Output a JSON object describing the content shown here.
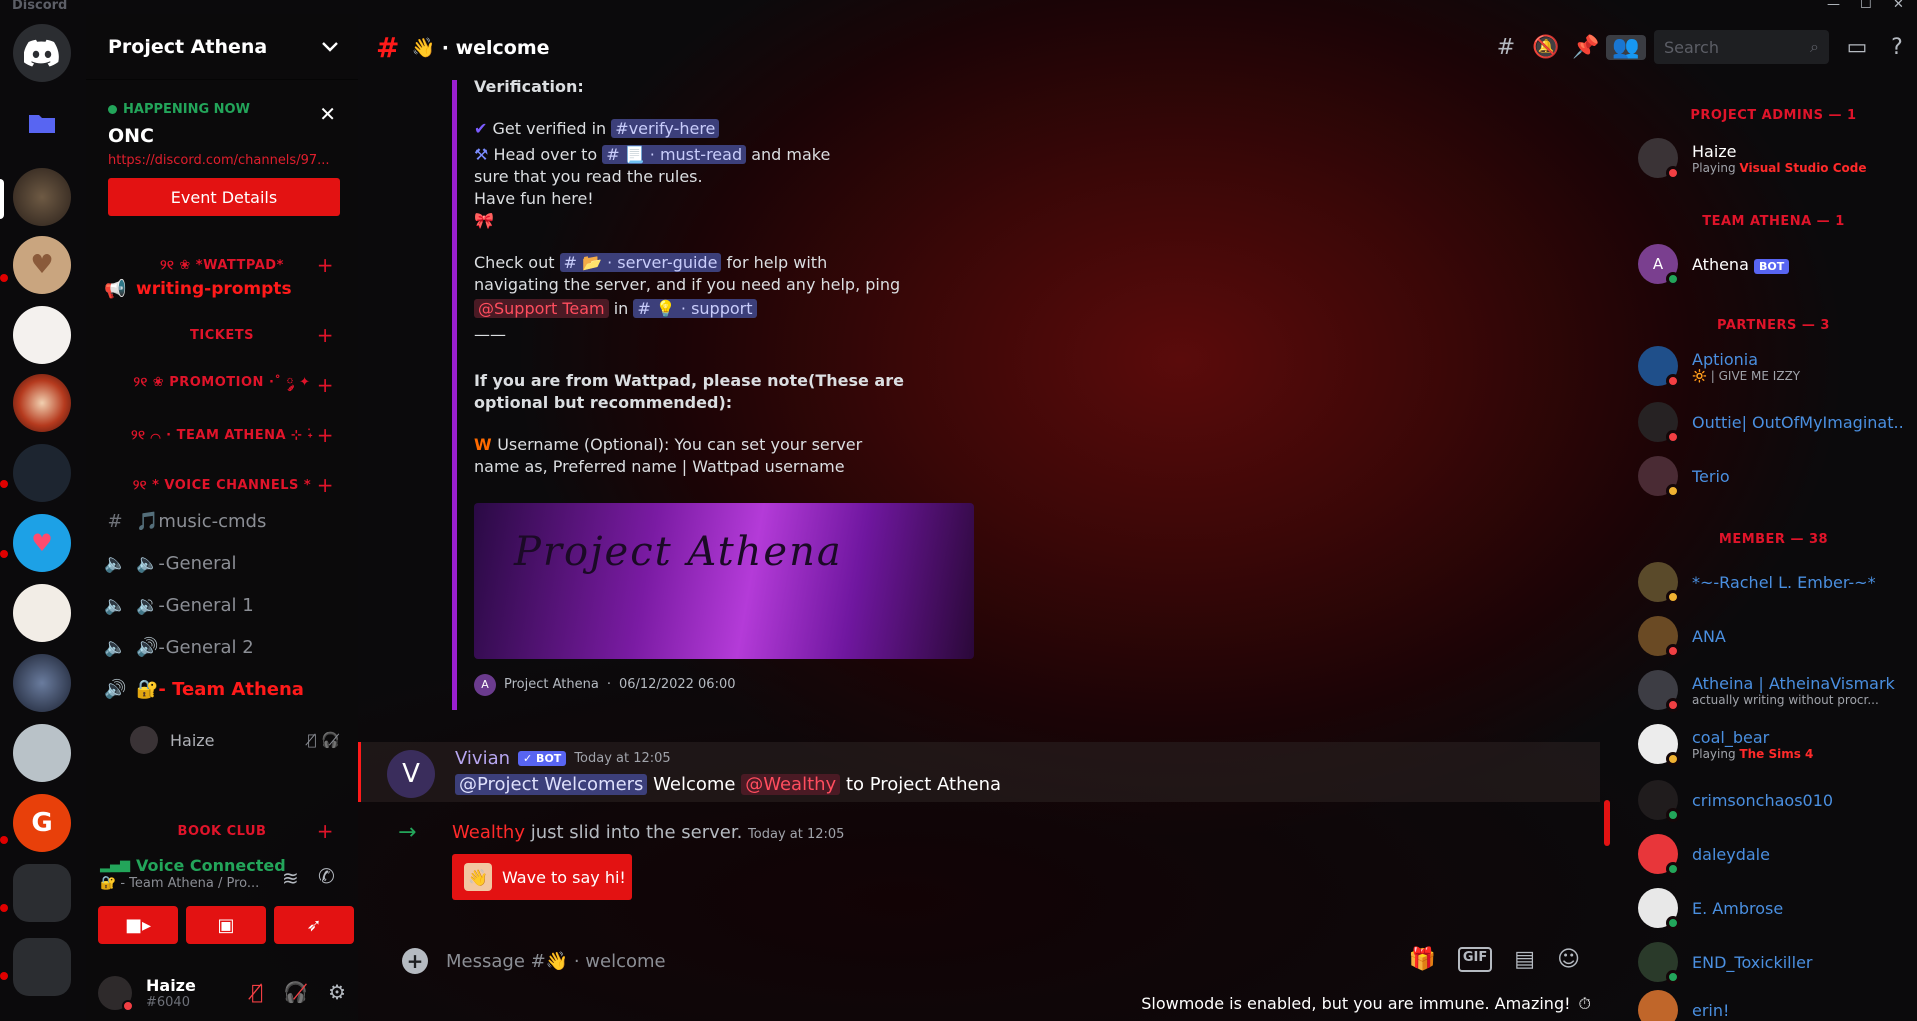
{
  "app": {
    "brand": "Discord"
  },
  "window": {
    "min": "—",
    "max": "☐",
    "close": "✕"
  },
  "server": {
    "name": "Project Athena"
  },
  "event": {
    "status": "HAPPENING NOW",
    "title": "ONC",
    "link": "https://discord.com/channels/97...",
    "button": "Event Details"
  },
  "channels": {
    "cat_wattpad": "୨୧ ❀ *WATTPAD* ",
    "writing_prompts": "writing-prompts",
    "cat_tickets": "TICKETS",
    "cat_promotion": "୨୧ ❀ PROMOTION ·˚ ༘ ✦",
    "cat_team": "୨୧ ⌒ · TEAM ATHENA ⊹ ࣪˖",
    "cat_voice": "୨୧ * VOICE CHANNELS *",
    "music": "🎵music-cmds",
    "general": "🔈-General",
    "general1": "🔉-General 1",
    "general2": "🔊-General 2",
    "team": "🔐- Team Athena",
    "voice_user": "Haize",
    "cat_book": "BOOK CLUB"
  },
  "voice": {
    "status": "Voice Connected",
    "sub": "🔐 - Team Athena / Pro..."
  },
  "user": {
    "name": "Haize",
    "tag": "#6040"
  },
  "topbar": {
    "channel": "👋 · welcome",
    "search_placeholder": "Search"
  },
  "embed": {
    "heading": "Verification:",
    "l1_a": "Get verified in",
    "l1_chip": "#verify-here",
    "l2_a": "Head over to",
    "l2_chip": "# 📃 · must-read",
    "l2_b": "and make",
    "l3": "sure that you read the rules.",
    "l4": "Have fun here!",
    "l6_a": "Check out",
    "l6_chip": "# 📂 · server-guide",
    "l6_b": "for help with",
    "l7": "navigating the server, and if you need any help, ping",
    "l8_mention": "@Support Team",
    "l8_in": "in",
    "l8_chip": "# 💡 · support",
    "sep": "——",
    "bold1": "If you are from Wattpad, please note(These are",
    "bold2": "optional but recommended):",
    "l12": "Username (Optional): You can set your server",
    "l13": "name as, Preferred name | Wattpad username",
    "banner_text": "Project Athena",
    "footer_name": "Project Athena",
    "footer_date": "06/12/2022 06:00"
  },
  "vivian": {
    "author": "Vivian",
    "bot": "✓ BOT",
    "time": "Today at 12:05",
    "mention1": "@Project Welcomers",
    "welcome": "Welcome",
    "mention2": "@Wealthy",
    "tail": "to Project Athena"
  },
  "join": {
    "who": "Wealthy",
    "text": "just slid into the server.",
    "time": "Today at 12:05",
    "button": "Wave to say hi!"
  },
  "composer": {
    "placeholder": "Message #👋 · welcome",
    "gif": "GIF"
  },
  "slowmode": "Slowmode is enabled, but you are immune. Amazing!",
  "members": {
    "cat_admins": "PROJECT ADMINS — 1",
    "cat_team": "TEAM ATHENA — 1",
    "cat_partners": "PARTNERS — 3",
    "cat_member": "MEMBER — 38",
    "haize": {
      "name": "Haize",
      "status_a": "Playing",
      "status_b": "Visual Studio Code"
    },
    "athena": {
      "name": "Athena",
      "tag": "BOT",
      "initial": "A"
    },
    "aptionia": {
      "name": "Aptionia",
      "status": "🔆 | GIVE ME IZZY"
    },
    "outtie": {
      "name": "Outtie| OutOfMyImaginat..."
    },
    "terio": {
      "name": "Terio"
    },
    "rachel": {
      "name": "*~-Rachel L. Ember-~*"
    },
    "ana": {
      "name": "ANA"
    },
    "atheina": {
      "name": "Atheina | AtheinaVismark",
      "status": "actually writing without procr..."
    },
    "coal": {
      "name": "coal_bear",
      "status_a": "Playing",
      "status_b": "The Sims 4"
    },
    "crimson": {
      "name": "crimsonchaos010"
    },
    "daley": {
      "name": "daleydale"
    },
    "ambrose": {
      "name": "E. Ambrose"
    },
    "end": {
      "name": "END_Toxickiller"
    },
    "erin": {
      "name": "erin!"
    }
  }
}
